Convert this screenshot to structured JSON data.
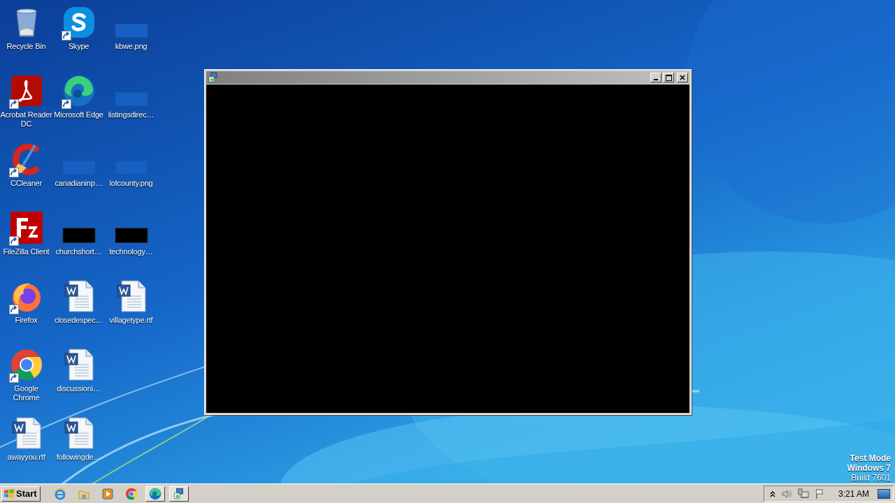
{
  "desktop": {
    "icon_columns": [
      [
        {
          "label": "Recycle Bin",
          "kind": "recycle",
          "shortcut": false
        },
        {
          "label": "Acrobat Reader DC",
          "kind": "acrobat",
          "shortcut": true
        },
        {
          "label": "CCleaner",
          "kind": "ccleaner",
          "shortcut": true
        },
        {
          "label": "FileZilla Client",
          "kind": "filezilla",
          "shortcut": true
        },
        {
          "label": "Firefox",
          "kind": "firefox",
          "shortcut": true
        },
        {
          "label": "Google Chrome",
          "kind": "chrome",
          "shortcut": true
        },
        {
          "label": "awayyou.rtf",
          "kind": "word",
          "shortcut": false
        }
      ],
      [
        {
          "label": "Skype",
          "kind": "skype",
          "shortcut": true
        },
        {
          "label": "Microsoft Edge",
          "kind": "edge",
          "shortcut": true
        },
        {
          "label": "canadianinp…",
          "kind": "image_blue",
          "shortcut": false
        },
        {
          "label": "churchshort…",
          "kind": "image_black",
          "shortcut": false
        },
        {
          "label": "closedespec…",
          "kind": "word",
          "shortcut": false
        },
        {
          "label": "discussioni…",
          "kind": "word",
          "shortcut": false
        },
        {
          "label": "followingde…",
          "kind": "word",
          "shortcut": false
        }
      ],
      [
        {
          "label": "kbwe.png",
          "kind": "image_blue",
          "shortcut": false
        },
        {
          "label": "listingsdirec…",
          "kind": "image_blue",
          "shortcut": false
        },
        {
          "label": "lotcounty.png",
          "kind": "image_blue",
          "shortcut": false
        },
        {
          "label": "technology…",
          "kind": "image_black",
          "shortcut": false
        },
        {
          "label": "villagetype.rtf",
          "kind": "word",
          "shortcut": false
        }
      ]
    ]
  },
  "os_notice": [
    "Test Mode",
    "Windows 7",
    "Build 7601"
  ],
  "taskbar": {
    "start": "Start",
    "items": [
      {
        "kind": "ie",
        "running": false
      },
      {
        "kind": "explorer",
        "running": false
      },
      {
        "kind": "media",
        "running": false
      },
      {
        "kind": "chrome",
        "running": false
      },
      {
        "kind": "edge",
        "running": true
      },
      {
        "kind": "app",
        "running": true
      }
    ],
    "tray": [
      {
        "kind": "chevron"
      },
      {
        "kind": "speaker"
      },
      {
        "kind": "network"
      },
      {
        "kind": "flag"
      }
    ],
    "clock": "3:21 AM"
  }
}
